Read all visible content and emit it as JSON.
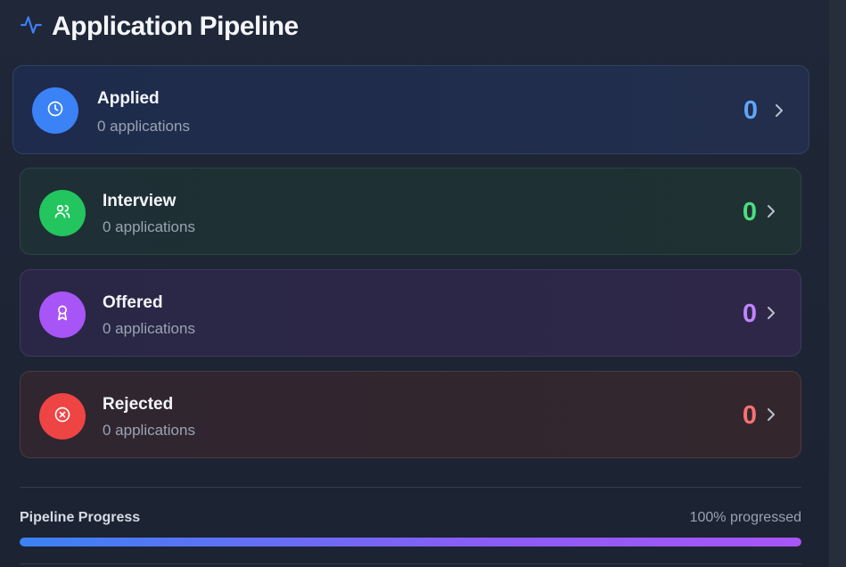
{
  "header": {
    "title": "Application Pipeline",
    "icon": "activity-icon",
    "icon_color": "#3b82f6"
  },
  "stages": [
    {
      "name": "Applied",
      "subtitle": "0 applications",
      "count": "0",
      "icon": "clock-icon",
      "color": "#3b82f6"
    },
    {
      "name": "Interview",
      "subtitle": "0 applications",
      "count": "0",
      "icon": "users-icon",
      "color": "#22c55e"
    },
    {
      "name": "Offered",
      "subtitle": "0 applications",
      "count": "0",
      "icon": "award-icon",
      "color": "#a855f7"
    },
    {
      "name": "Rejected",
      "subtitle": "0 applications",
      "count": "0",
      "icon": "x-circle-icon",
      "color": "#ef4444"
    }
  ],
  "progress": {
    "label": "Pipeline Progress",
    "value_text": "100% progressed",
    "percent": 100
  }
}
